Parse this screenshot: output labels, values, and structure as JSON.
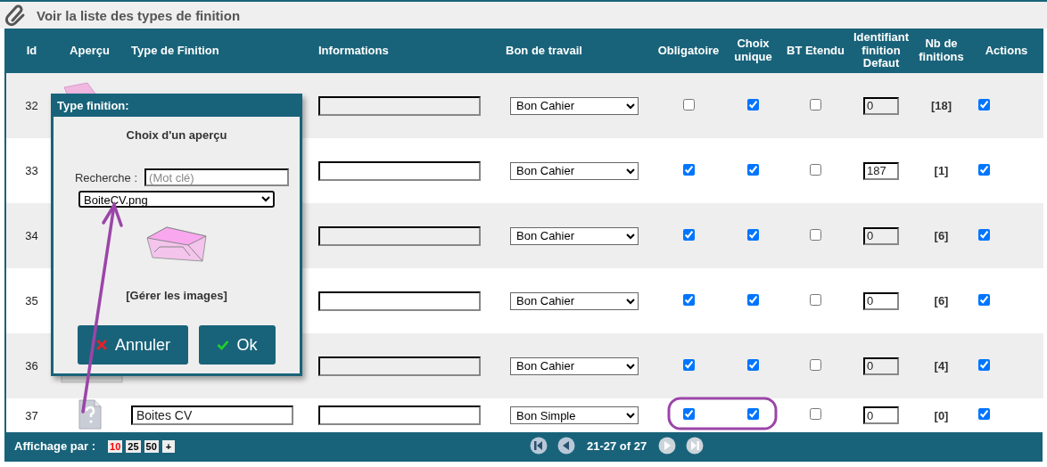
{
  "page_title": "Voir la liste des types de finition",
  "table": {
    "columns": [
      "Id",
      "Aperçu",
      "Type de Finition",
      "Informations",
      "Bon de travail",
      "Obligatoire",
      "Choix unique",
      "BT Etendu",
      "Identifiant finition Defaut",
      "Nb de finitions",
      "Actions"
    ],
    "rows": [
      {
        "id": "32",
        "kind": "box",
        "bon": "Bon Cahier",
        "obligatoire": false,
        "choix_unique": true,
        "bt_etendu": false,
        "defaut": "0",
        "nb": "[18]",
        "action": true
      },
      {
        "id": "33",
        "bon": "Bon Cahier",
        "obligatoire": true,
        "choix_unique": true,
        "bt_etendu": false,
        "defaut": "187",
        "nb": "[1]",
        "action": true
      },
      {
        "id": "34",
        "bon": "Bon Cahier",
        "obligatoire": true,
        "choix_unique": true,
        "bt_etendu": false,
        "defaut": "0",
        "nb": "[6]",
        "action": true
      },
      {
        "id": "35",
        "bon": "Bon Cahier",
        "obligatoire": true,
        "choix_unique": true,
        "bt_etendu": false,
        "defaut": "0",
        "nb": "[6]",
        "action": true
      },
      {
        "id": "36",
        "kind": "tray",
        "bon": "Bon Cahier",
        "obligatoire": true,
        "choix_unique": true,
        "bt_etendu": false,
        "defaut": "0",
        "nb": "[4]",
        "action": true
      },
      {
        "id": "37",
        "kind": "unknown",
        "type": "Boites CV",
        "bon": "Bon Simple",
        "obligatoire": true,
        "choix_unique": true,
        "bt_etendu": false,
        "defaut": "0",
        "nb": "[0]",
        "action": true
      }
    ]
  },
  "footer": {
    "label": "Affichage par :",
    "page_sizes": [
      {
        "label": "10",
        "selected": true
      },
      {
        "label": "25",
        "selected": false
      },
      {
        "label": "50",
        "selected": false
      },
      {
        "label": "+",
        "selected": false
      }
    ],
    "pager": [
      {
        "kind": "first",
        "disabled": false
      },
      {
        "kind": "prev",
        "disabled": false
      },
      {
        "kind": "range",
        "label": "21-27 of 27"
      },
      {
        "kind": "next",
        "disabled": true
      },
      {
        "kind": "last",
        "disabled": true
      }
    ]
  },
  "dialog": {
    "title": "Type finition:",
    "heading": "Choix d'un aperçu",
    "search_label": "Recherche :",
    "search_placeholder": "(Mot clé)",
    "image_select": "BoiteCV.png",
    "manage_link": "[Gérer les images]",
    "buttons": [
      {
        "kind": "cancel",
        "label": "Annuler"
      },
      {
        "kind": "ok",
        "label": "Ok"
      }
    ]
  },
  "annotations": {
    "arrow": true,
    "highlight_ring": true
  }
}
